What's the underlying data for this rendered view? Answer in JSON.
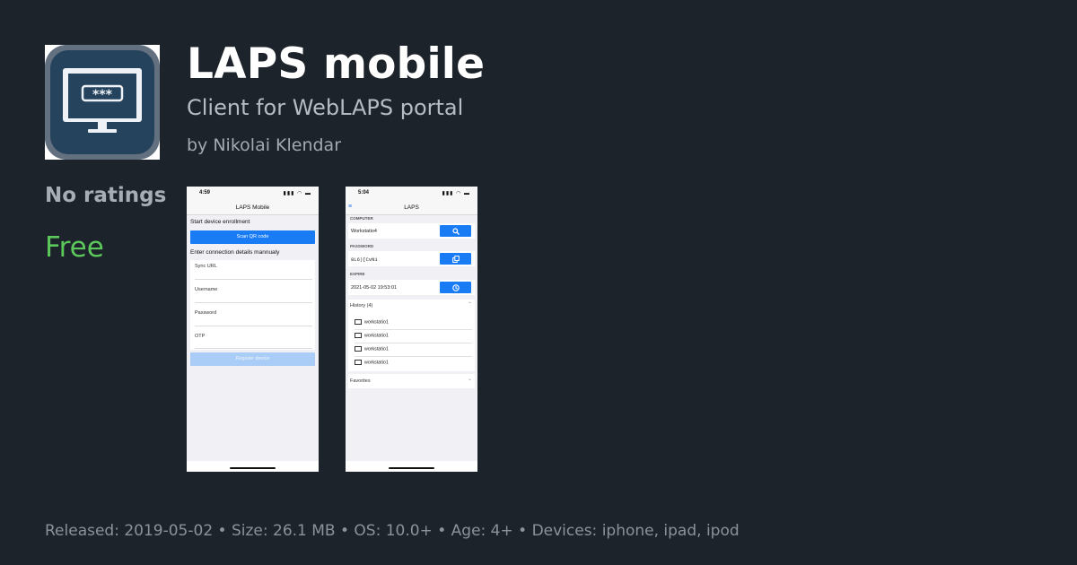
{
  "app": {
    "title": "LAPS mobile",
    "subtitle": "Client for WebLAPS portal",
    "author": "by Nikolai Klendar",
    "ratings": "No ratings",
    "price": "Free",
    "icon": "monitor-password-icon",
    "icon_password_mask": "***"
  },
  "footer": {
    "text": "Released: 2019-05-02 • Size: 26.1 MB • OS: 10.0+ • Age: 4+ • Devices: iphone, ipad, ipod"
  },
  "colors": {
    "background": "#1d232a",
    "price": "#5cc85c",
    "accent_button": "#1a7cf5"
  },
  "screenshot1": {
    "time": "4:59",
    "status_icons": "▮▮▮ ◠ ▬",
    "nav_title": "LAPS Mobile",
    "start_enrollment": "Start device enrollment",
    "scan_qr_button": "Scan QR code",
    "manual_label": "Enter connection details mannualy",
    "fields": [
      "Sync URL",
      "Username",
      "Password",
      "OTP"
    ],
    "register_button": "Register device"
  },
  "screenshot2": {
    "time": "5:04",
    "status_icons": "▮▮▮ ◠ ▬",
    "menu_icon": "≡",
    "nav_title": "LAPS",
    "computer_label": "COMPUTER",
    "computer_value": "Workstatio4",
    "password_label": "PASSWORD",
    "password_value": "8L6)[CvN1",
    "expire_label": "EXPIRE",
    "expire_value": "2021-05-02 19:53:01",
    "history_label": "History (4)",
    "history_items": [
      "workstatio1",
      "workstatio1",
      "workstatio1",
      "workstatio1"
    ],
    "favorites_label": "Favorites"
  }
}
